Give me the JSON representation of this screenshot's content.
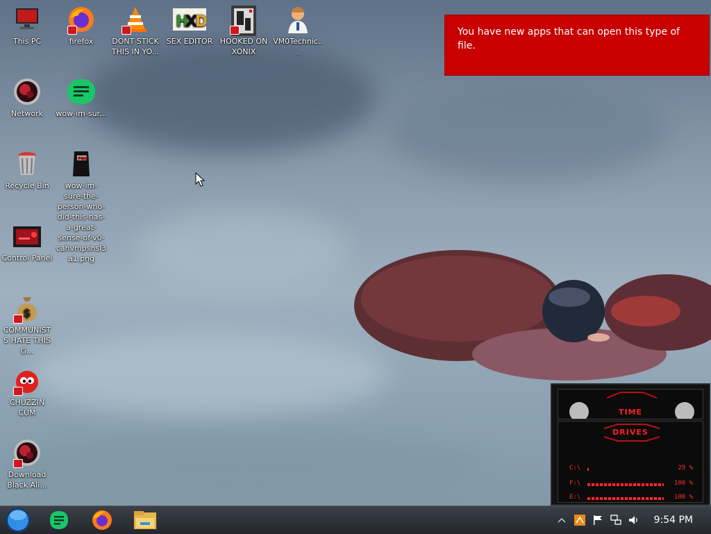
{
  "desktop": {
    "icons": [
      {
        "label": "This PC",
        "icon": "computer-icon"
      },
      {
        "label": "firefox",
        "icon": "firefox-icon"
      },
      {
        "label": "DONT STICK THIS IN YO...",
        "icon": "vlc-icon"
      },
      {
        "label": "SEX EDITOR",
        "icon": "hxd-hex-editor-icon"
      },
      {
        "label": "HOOKED ON XONIX",
        "icon": "xonix-game-icon"
      },
      {
        "label": "VM0Technic...",
        "icon": "doctor-person-icon"
      },
      {
        "label": "Network",
        "icon": "network-orb-icon"
      },
      {
        "label": "wow-im-sur...",
        "icon": "text-document-icon"
      },
      {
        "label": "Recycle Bin",
        "icon": "recycle-bin-icon"
      },
      {
        "label": "wow-im-sure-the-person-who-did-this-has-a-great-sense-of-v0-cahvmpsnsl3a1.png",
        "icon": "png-file-icon"
      },
      {
        "label": "Control Panel",
        "icon": "control-panel-icon"
      },
      {
        "label": "COMMUNISTS HATE THIS G...",
        "icon": "money-bag-icon"
      },
      {
        "label": "CHUZZIN CUM",
        "icon": "chuzzle-icon"
      },
      {
        "label": "Download Black Ali...",
        "icon": "alien-orb-icon"
      }
    ]
  },
  "notification": {
    "text": "You have new apps that can open this type of file."
  },
  "taskbar": {
    "start": "start-orb-icon",
    "pinned": [
      "notes-app-icon",
      "firefox-icon",
      "file-explorer-icon"
    ],
    "tray": {
      "icons": [
        "chevron-up-icon",
        "app-tray-icon",
        "flag-icon",
        "network-icon",
        "volume-icon"
      ],
      "time": "9:54 PM"
    }
  },
  "widget": {
    "time_title": "TIME",
    "drives_title": "DRIVES",
    "drives": [
      {
        "letter": "C:\\",
        "percent": "29 %",
        "fill": 0.29
      },
      {
        "letter": "F:\\",
        "percent": "100 %",
        "fill": 1.0
      },
      {
        "letter": "E:\\",
        "percent": "100 %",
        "fill": 1.0
      }
    ]
  },
  "colors": {
    "toast_bg": "#c80000",
    "widget_accent": "#ff2020"
  }
}
